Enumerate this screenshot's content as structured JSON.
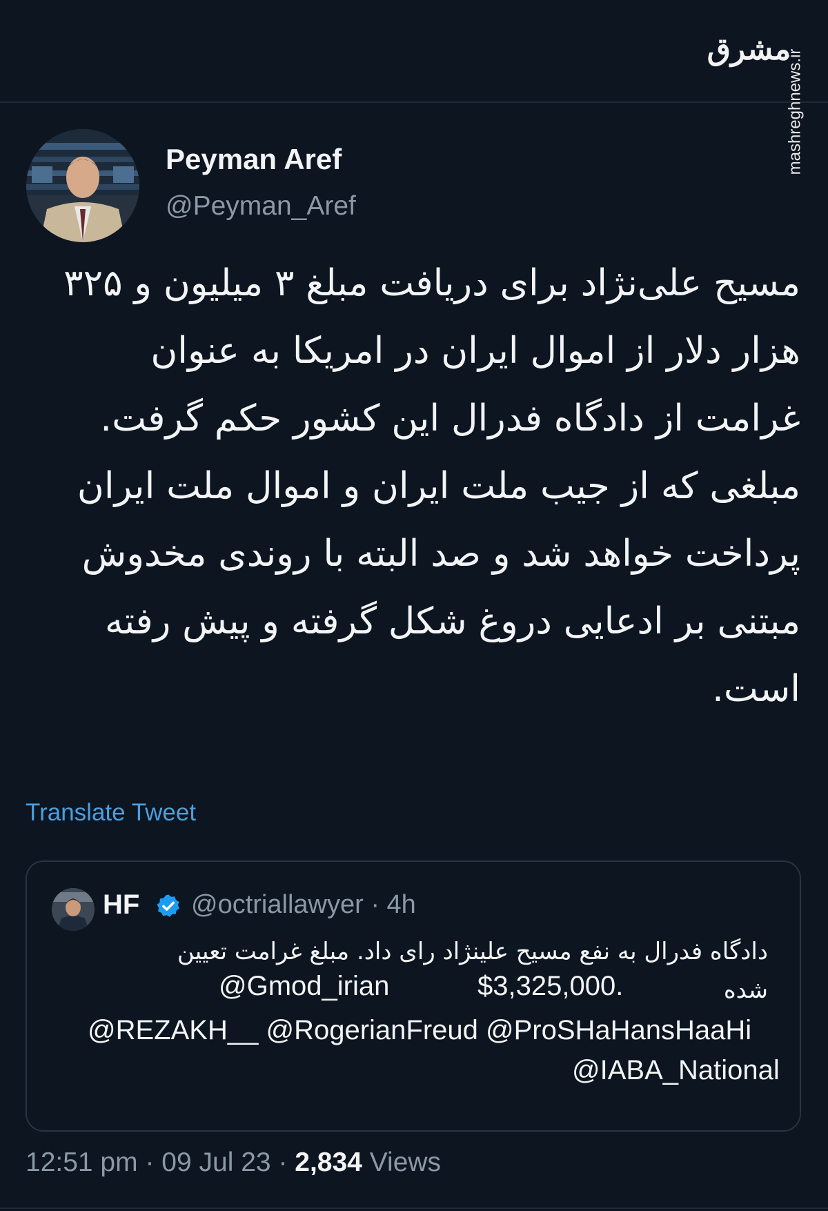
{
  "watermark": {
    "logo": "مشرق",
    "url": "mashreghnews.ir"
  },
  "author": {
    "name": "Peyman Aref",
    "handle": "@Peyman_Aref"
  },
  "tweet": {
    "paragraphs": [
      "مسیح علی‌نژاد برای دریافت مبلغ ۳ میلیون و ۳۲۵ هزار دلار از اموال ایران در امریکا به عنوان غرامت از دادگاه فدرال این کشور حکم گرفت.",
      "مبلغی که از جیب ملت ایران و اموال ملت ایران پرداخت خواهد شد و صد البته با روندی مخدوش مبتنی بر ادعایی دروغ شکل گرفته و پیش رفته است."
    ],
    "translate_label": "Translate Tweet"
  },
  "quote": {
    "name": "HF",
    "handle": "@octriallawyer",
    "separator": "·",
    "time": "4h",
    "line1": "دادگاه فدرال به نفع مسیح علینژاد رای داد. مبلغ غرامت تعیین",
    "line2_fa": "شده",
    "line2_amount": "$3,325,000.",
    "line2_mention": "@Gmod_irian",
    "line3": "@REZAKH__ @RogerianFreud @ProSHaHansHaaHi",
    "line4": "@IABA_National"
  },
  "meta": {
    "time": "12:51 pm",
    "sep": "·",
    "date": "09 Jul 23",
    "views_count": "2,834",
    "views_label": "Views"
  },
  "colors": {
    "background": "#0d1520",
    "link": "#4a9fe0",
    "verified": "#1d9bf0"
  }
}
